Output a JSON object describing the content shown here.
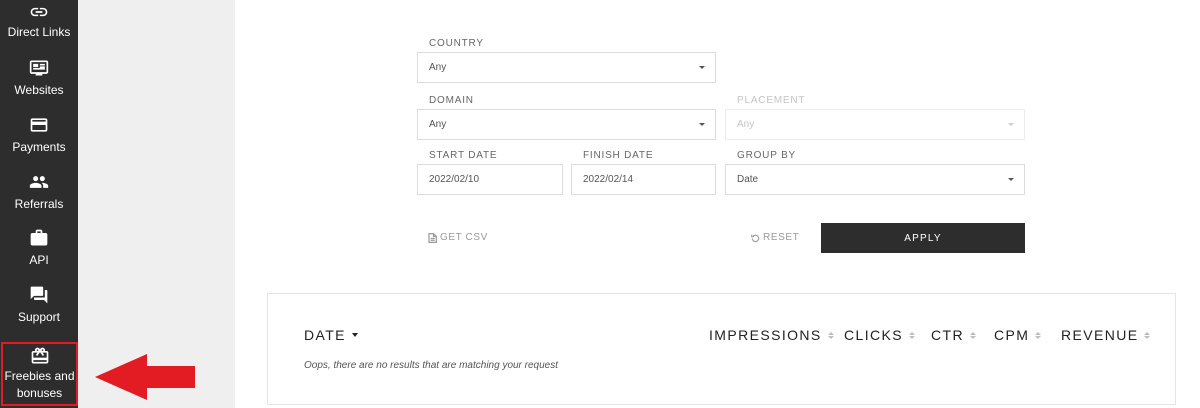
{
  "sidebar": {
    "items": [
      {
        "label": "Direct Links",
        "icon": "link-icon"
      },
      {
        "label": "Websites",
        "icon": "websites-icon"
      },
      {
        "label": "Payments",
        "icon": "payment-card-icon"
      },
      {
        "label": "Referrals",
        "icon": "people-icon"
      },
      {
        "label": "API",
        "icon": "briefcase-icon"
      },
      {
        "label": "Support",
        "icon": "chat-icon"
      },
      {
        "label": "Freebies and bonuses",
        "icon": "gift-icon"
      }
    ],
    "highlight_color": "#e31b23"
  },
  "filters": {
    "country": {
      "label": "COUNTRY",
      "value": "Any"
    },
    "domain": {
      "label": "DOMAIN",
      "value": "Any"
    },
    "placement": {
      "label": "PLACEMENT",
      "value": "Any"
    },
    "start_date": {
      "label": "START DATE",
      "value": "2022/02/10"
    },
    "finish_date": {
      "label": "FINISH DATE",
      "value": "2022/02/14"
    },
    "group_by": {
      "label": "GROUP BY",
      "value": "Date"
    }
  },
  "actions": {
    "get_csv": "GET CSV",
    "reset": "RESET",
    "apply": "APPLY"
  },
  "results": {
    "columns": [
      "DATE",
      "IMPRESSIONS",
      "CLICKS",
      "CTR",
      "CPM",
      "REVENUE"
    ],
    "empty_message": "Oops, there are no results that are matching your request"
  }
}
